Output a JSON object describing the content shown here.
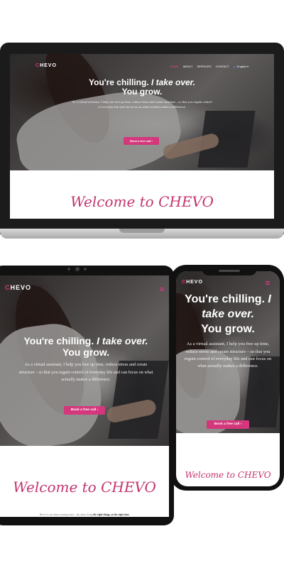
{
  "brand": {
    "logo_prefix": "C",
    "logo_rest": "HEVO",
    "accent": "#d4377c"
  },
  "nav": {
    "items": [
      "HOME",
      "ABOUT",
      "SERVICES",
      "CONTACT"
    ],
    "language": "English"
  },
  "hero": {
    "title_plain": "You're chilling.",
    "title_italic": "I take over.",
    "title_end": "You grow.",
    "subtitle": "As a virtual assistant, I help you free up time, reduce stress and create structure – so that you regain control of everyday life and can focus on what actually makes a difference.",
    "cta_label": "Book a free call",
    "cta_arrow": "›"
  },
  "welcome": {
    "heading": "Welcome to CHEVO"
  },
  "tablet_footer": {
    "text_plain": "Here it is not about running faster – but about doing",
    "text_bold": "the right things, at the right time."
  }
}
